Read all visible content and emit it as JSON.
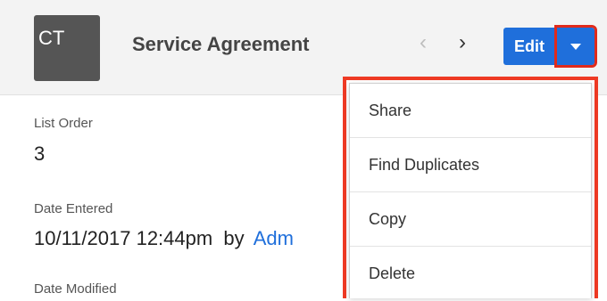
{
  "header": {
    "avatar_text": "CT",
    "title": "Service Agreement",
    "prev_icon": "‹",
    "next_icon": "›",
    "edit_label": "Edit"
  },
  "fields": {
    "list_order_label": "List Order",
    "list_order_value": "3",
    "date_entered_label": "Date Entered",
    "date_entered_value": "10/11/2017 12:44pm",
    "date_entered_by": "by",
    "date_entered_user": "Adm",
    "date_modified_label": "Date Modified"
  },
  "menu": {
    "items": [
      {
        "label": "Share"
      },
      {
        "label": "Find Duplicates"
      },
      {
        "label": "Copy"
      },
      {
        "label": "Delete"
      }
    ]
  },
  "colors": {
    "accent": "#1f6fdb",
    "highlight": "#e02a1b"
  }
}
